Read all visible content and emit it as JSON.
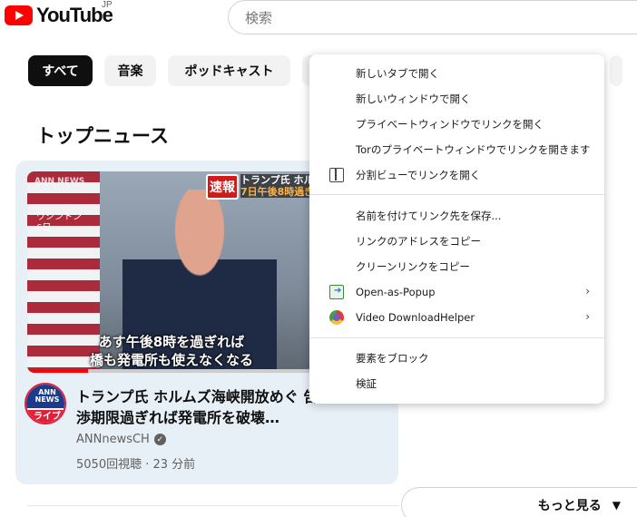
{
  "header": {
    "logo_text": "YouTube",
    "country": "JP",
    "search_placeholder": "検索"
  },
  "chips": [
    "すべて",
    "音楽",
    "ポッドキャスト"
  ],
  "section": {
    "title": "トップニュース"
  },
  "video": {
    "thumb_badge": "速報",
    "thumb_headline_1": "トランプ氏 ホルム",
    "thumb_headline_2": "7日午後8時過ぎ",
    "thumb_location_1": "ワシントン",
    "thumb_location_2": "6日",
    "caption_1": "あす午後8時を過ぎれば",
    "caption_2": "橋も発電所も使えなくなる",
    "progress": 0.21,
    "avatar_top": "ANN NEWS",
    "avatar_live": "ライブ",
    "title": "トランプ氏 ホルムズ海峡開放めぐ 告　交渉期限過ぎれば発電所を破壊…",
    "channel": "ANNnewsCH",
    "verified_icon": "checkmark-icon",
    "meta": "5050回視聴 · 23 分前"
  },
  "more_button": {
    "label": "もっと見る",
    "icon": "chevron-down-icon"
  },
  "context_menu": {
    "items": [
      {
        "label": "新しいタブで開く"
      },
      {
        "label": "新しいウィンドウで開く"
      },
      {
        "label": "プライベートウィンドウでリンクを開く"
      },
      {
        "label": "Torのプライベートウィンドウでリンクを開きます"
      },
      {
        "label": "分割ビューでリンクを開く",
        "icon": "split-view-icon"
      },
      {
        "label": "名前を付けてリンク先を保存..."
      },
      {
        "label": "リンクのアドレスをコピー"
      },
      {
        "label": "クリーンリンクをコピー"
      },
      {
        "label": "Open-as-Popup",
        "icon": "popup-extension-icon",
        "submenu": "›"
      },
      {
        "label": "Video DownloadHelper",
        "icon": "video-downloadhelper-icon",
        "submenu": "›"
      },
      {
        "label": "要素をブロック"
      },
      {
        "label": "検証"
      }
    ]
  }
}
